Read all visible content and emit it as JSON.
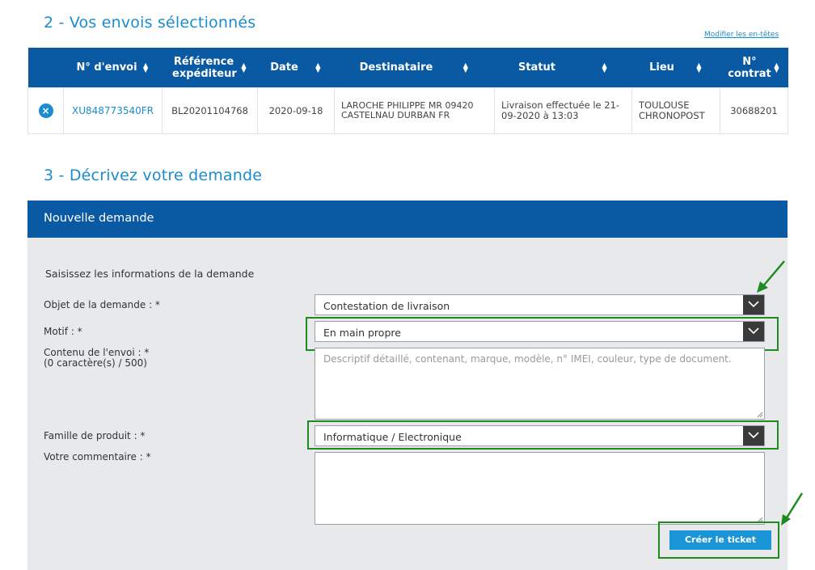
{
  "section2": {
    "title": "2 - Vos envois sélectionnés",
    "modify_link": "Modifier les en-têtes"
  },
  "table": {
    "headers": [
      "N° d'envoi",
      "Référence expéditeur",
      "Date",
      "Destinataire",
      "Statut",
      "Lieu",
      "N° contrat"
    ],
    "rows": [
      {
        "remove_icon": "×",
        "numero": "XU848773540FR",
        "reference": "BL20201104768",
        "date": "2020-09-18",
        "destinataire": "LAROCHE PHILIPPE MR 09420 CASTELNAU DURBAN FR",
        "statut": "Livraison effectuée le 21-09-2020 à 13:03",
        "lieu": "TOULOUSE CHRONOPOST",
        "contrat": "30688201"
      }
    ]
  },
  "section3": {
    "title": "3 - Décrivez votre demande"
  },
  "panel": {
    "title": "Nouvelle demande",
    "subtitle": "Saisissez les informations de la demande",
    "objet": {
      "label": "Objet de la demande : *",
      "value": "Contestation de livraison"
    },
    "motif": {
      "label": "Motif : *",
      "value": "En main propre"
    },
    "contenu": {
      "label": "Contenu de l'envoi  : *",
      "counter": "(0 caractère(s) / 500)",
      "placeholder": "Descriptif détaillé, contenant, marque, modèle, n° IMEI, couleur, type de document."
    },
    "famille": {
      "label": "Famille de produit : *",
      "value": "Informatique / Electronique"
    },
    "commentaire": {
      "label": "Votre commentaire : *"
    },
    "submit_label": "Créer le ticket"
  },
  "colors": {
    "brand_blue": "#0a5aa3",
    "link_blue": "#1a8ccf",
    "highlight_green": "#1f8a1f",
    "panel_bg": "#e8e9eb"
  }
}
